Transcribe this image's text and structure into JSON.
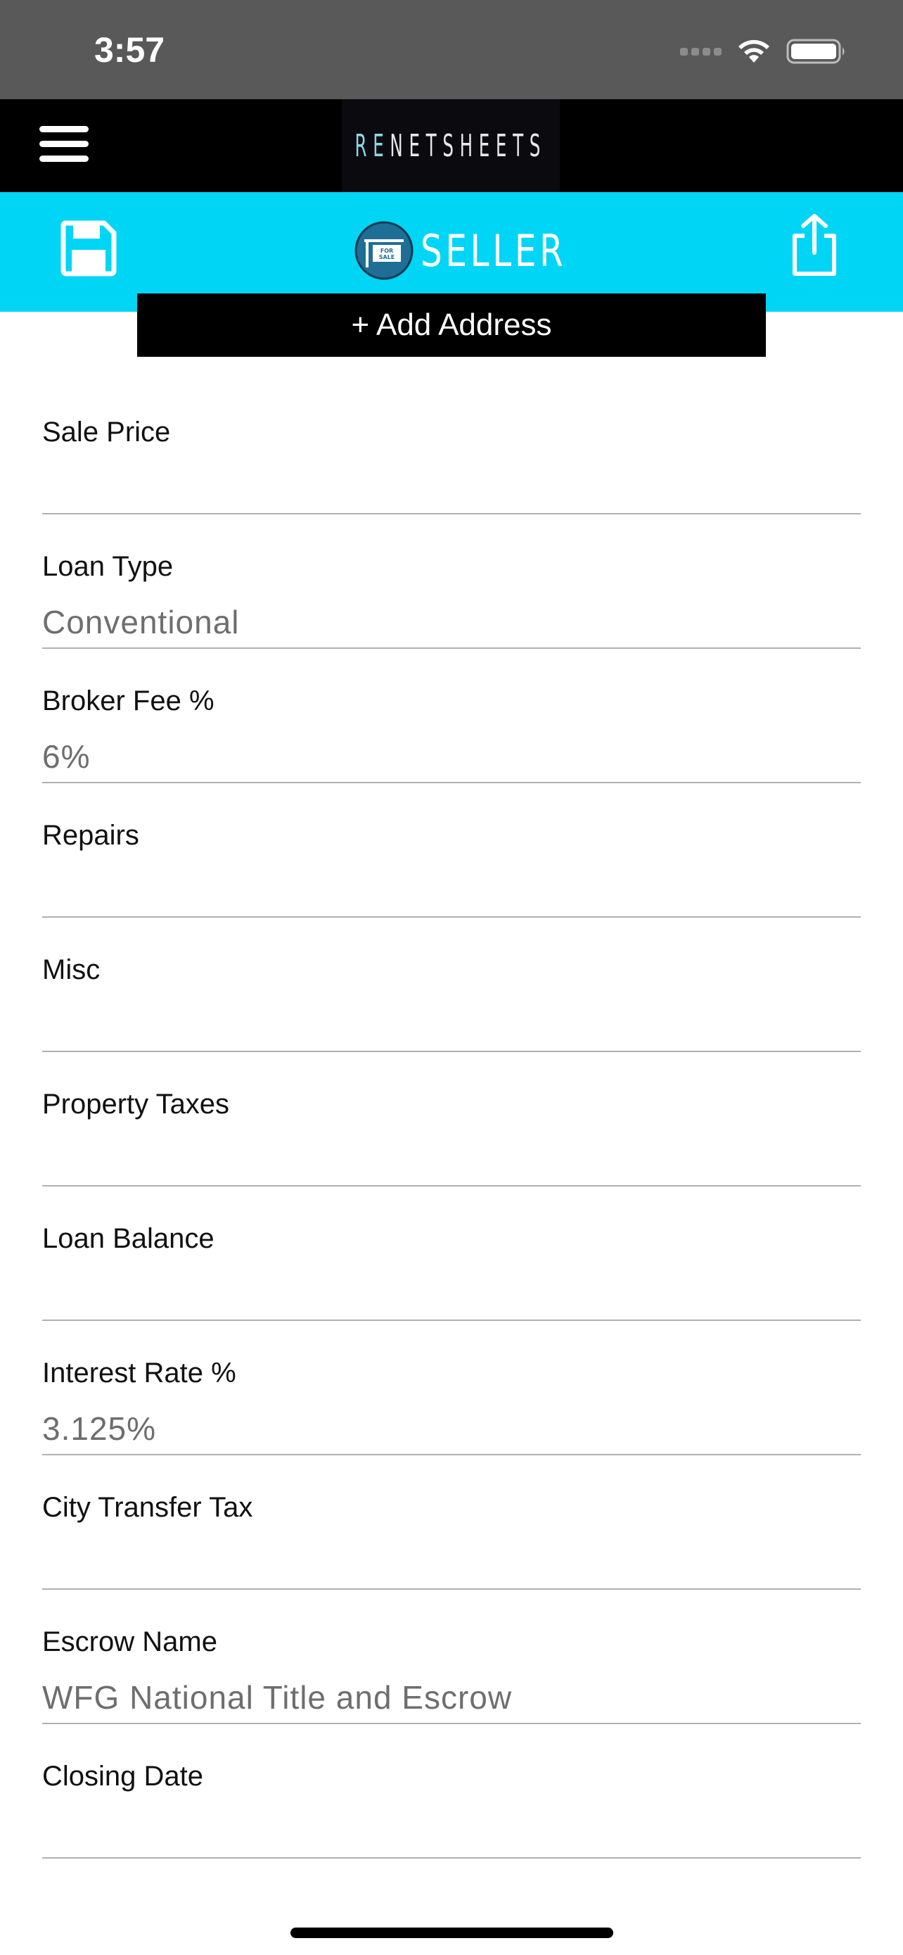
{
  "status_bar": {
    "time": "3:57"
  },
  "header": {
    "logo_prefix": "RE",
    "logo_main": "NETSHEETS"
  },
  "toolbar": {
    "title": "SELLER",
    "badge_text": "FOR SALE",
    "accent_color": "#00d5f5"
  },
  "add_address_label": "+ Add Address",
  "fields": [
    {
      "label": "Sale Price",
      "value": ""
    },
    {
      "label": "Loan Type",
      "value": "Conventional"
    },
    {
      "label": "Broker Fee %",
      "value": "6%"
    },
    {
      "label": "Repairs",
      "value": ""
    },
    {
      "label": "Misc",
      "value": ""
    },
    {
      "label": "Property Taxes",
      "value": ""
    },
    {
      "label": "Loan Balance",
      "value": ""
    },
    {
      "label": "Interest Rate %",
      "value": "3.125%"
    },
    {
      "label": "City Transfer Tax",
      "value": ""
    },
    {
      "label": "Escrow Name",
      "value": "WFG National Title and Escrow"
    },
    {
      "label": "Closing Date",
      "value": ""
    }
  ]
}
